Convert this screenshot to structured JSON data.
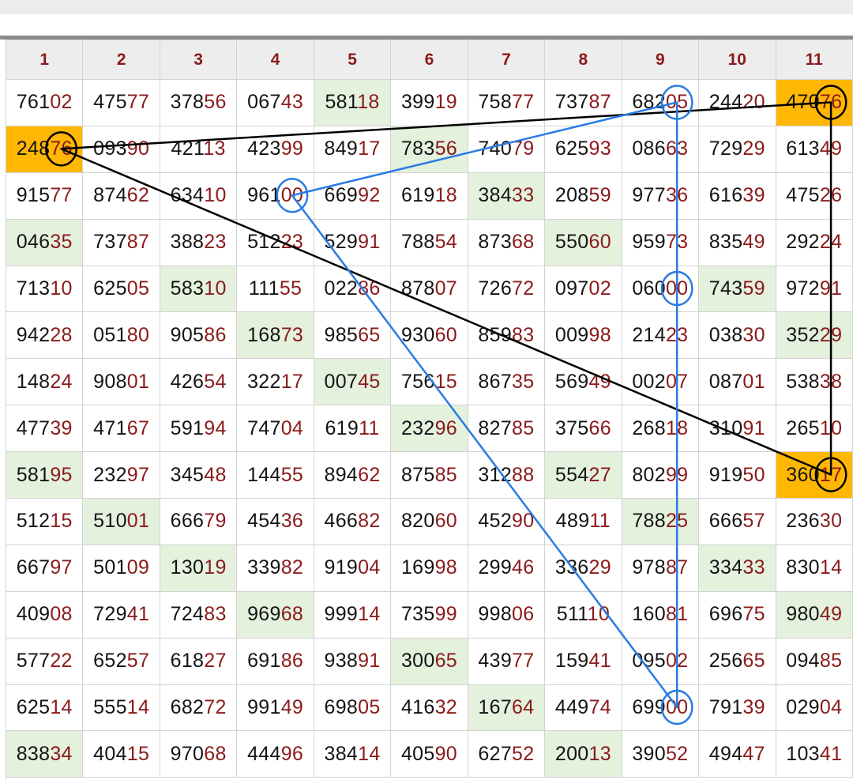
{
  "columns": [
    "1",
    "2",
    "3",
    "4",
    "5",
    "6",
    "7",
    "8",
    "9",
    "10",
    "11"
  ],
  "rows": [
    [
      "76102",
      "47577",
      "37856",
      "06743",
      "58118",
      "39919",
      "75877",
      "73787",
      "68205",
      "24420",
      "47076"
    ],
    [
      "24876",
      "09390",
      "42113",
      "42399",
      "84917",
      "78356",
      "74079",
      "62593",
      "08663",
      "72929",
      "61349"
    ],
    [
      "91577",
      "87462",
      "63410",
      "96100",
      "66992",
      "61918",
      "38433",
      "20859",
      "97736",
      "61639",
      "47526"
    ],
    [
      "04635",
      "73787",
      "38823",
      "51223",
      "52991",
      "78854",
      "87368",
      "55060",
      "95973",
      "83549",
      "29224"
    ],
    [
      "71310",
      "62505",
      "58310",
      "11155",
      "02286",
      "87807",
      "72672",
      "09702",
      "06000",
      "74359",
      "97291"
    ],
    [
      "94228",
      "05180",
      "90586",
      "16873",
      "98565",
      "93060",
      "85983",
      "00998",
      "21423",
      "03830",
      "35229"
    ],
    [
      "14824",
      "90801",
      "42654",
      "32217",
      "00745",
      "75615",
      "86735",
      "56949",
      "00207",
      "08701",
      "53838"
    ],
    [
      "47739",
      "47167",
      "59194",
      "74704",
      "61911",
      "23296",
      "82785",
      "37566",
      "26818",
      "31091",
      "26510"
    ],
    [
      "58195",
      "23297",
      "34548",
      "14455",
      "89462",
      "87585",
      "31288",
      "55427",
      "80299",
      "91950",
      "36017"
    ],
    [
      "51215",
      "51001",
      "66679",
      "45436",
      "46682",
      "82060",
      "45290",
      "48911",
      "78825",
      "66657",
      "23630"
    ],
    [
      "66797",
      "50109",
      "13019",
      "33982",
      "91904",
      "16998",
      "29946",
      "33629",
      "97887",
      "33433",
      "83014"
    ],
    [
      "40908",
      "72941",
      "72483",
      "96968",
      "99914",
      "73599",
      "99806",
      "51110",
      "16081",
      "69675",
      "98049"
    ],
    [
      "57722",
      "65257",
      "61827",
      "69186",
      "93891",
      "30065",
      "43977",
      "15941",
      "09502",
      "25665",
      "09485"
    ],
    [
      "62514",
      "55514",
      "68272",
      "99149",
      "69805",
      "41632",
      "16764",
      "44974",
      "69900",
      "79139",
      "02904"
    ],
    [
      "83834",
      "40415",
      "97068",
      "44496",
      "38414",
      "40590",
      "62752",
      "20013",
      "39052",
      "49447",
      "10341"
    ]
  ],
  "green_cells": [
    [
      0,
      4
    ],
    [
      1,
      5
    ],
    [
      2,
      6
    ],
    [
      3,
      0
    ],
    [
      3,
      7
    ],
    [
      4,
      2
    ],
    [
      4,
      9
    ],
    [
      5,
      3
    ],
    [
      5,
      10
    ],
    [
      6,
      4
    ],
    [
      7,
      5
    ],
    [
      8,
      0
    ],
    [
      8,
      7
    ],
    [
      9,
      1
    ],
    [
      9,
      8
    ],
    [
      10,
      2
    ],
    [
      10,
      9
    ],
    [
      11,
      3
    ],
    [
      11,
      10
    ],
    [
      12,
      5
    ],
    [
      13,
      6
    ],
    [
      14,
      0
    ],
    [
      14,
      7
    ]
  ],
  "highlighted_cells": [
    [
      0,
      10
    ],
    [
      1,
      0
    ],
    [
      8,
      10
    ]
  ],
  "circled_cells_black": [
    [
      0,
      10
    ],
    [
      1,
      0
    ],
    [
      8,
      10
    ]
  ],
  "circled_cells_blue": [
    [
      0,
      8
    ],
    [
      2,
      3
    ],
    [
      4,
      8
    ],
    [
      13,
      8
    ]
  ],
  "colors": {
    "cell_green": "#e3f1dd",
    "cell_orange": "#ffb703",
    "tail_digits": "#8b1a1a",
    "line_black": "#000000",
    "line_blue": "#2a7be4"
  }
}
